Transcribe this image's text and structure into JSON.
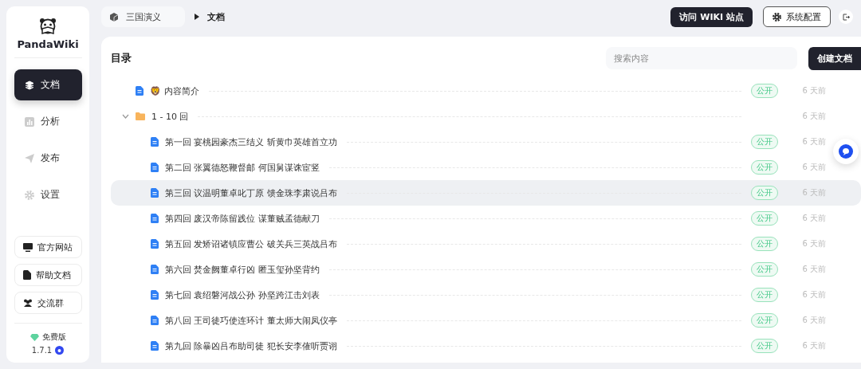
{
  "sidebar": {
    "logo": "PandaWiki",
    "nav": [
      {
        "label": "文档",
        "kind": "docs",
        "selected": true
      },
      {
        "label": "分析",
        "kind": "stats",
        "selected": false
      },
      {
        "label": "发布",
        "kind": "send",
        "selected": false
      },
      {
        "label": "设置",
        "kind": "gear",
        "selected": false
      }
    ],
    "links": [
      {
        "label": "官方网站",
        "kind": "monitor"
      },
      {
        "label": "帮助文档",
        "kind": "file"
      },
      {
        "label": "交流群",
        "kind": "group"
      }
    ],
    "edition": "免费版",
    "version": "1.7.1"
  },
  "header": {
    "breadcrumb": [
      "三国演义",
      "文档"
    ],
    "visit_button": "访问 WIKI 站点",
    "settings_button": "系统配置"
  },
  "catalog": {
    "title": "目录",
    "search": {
      "placeholder": "搜索内容"
    },
    "create_button": "创建文档",
    "items": [
      {
        "kind": "doc",
        "emoji": "🦁",
        "title": "内容简介",
        "status": "公开",
        "time": "6 天前",
        "selected": false
      },
      {
        "kind": "folder",
        "title": "1 - 10 回",
        "time": "6 天前",
        "expanded": true,
        "selected": false,
        "children": [
          {
            "kind": "doc",
            "title": "第一回 宴桃园豪杰三结义 斩黄巾英雄首立功",
            "status": "公开",
            "time": "6 天前",
            "selected": false
          },
          {
            "kind": "doc",
            "title": "第二回 张翼德怒鞭督邮 何国舅谋诛宦竖",
            "status": "公开",
            "time": "6 天前",
            "selected": false
          },
          {
            "kind": "doc",
            "title": "第三回 议温明董卓叱丁原 馈金珠李肃说吕布",
            "status": "公开",
            "time": "6 天前",
            "selected": true
          },
          {
            "kind": "doc",
            "title": "第四回 废汉帝陈留践位 谋董贼孟德献刀",
            "status": "公开",
            "time": "6 天前",
            "selected": false
          },
          {
            "kind": "doc",
            "title": "第五回 发矫诏诸镇应曹公 破关兵三英战吕布",
            "status": "公开",
            "time": "6 天前",
            "selected": false
          },
          {
            "kind": "doc",
            "title": "第六回 焚金阙董卓行凶 匿玉玺孙坚背约",
            "status": "公开",
            "time": "6 天前",
            "selected": false
          },
          {
            "kind": "doc",
            "title": "第七回 袁绍磐河战公孙 孙坚跨江击刘表",
            "status": "公开",
            "time": "6 天前",
            "selected": false
          },
          {
            "kind": "doc",
            "title": "第八回 王司徒巧使连环计 董太师大闹凤仪亭",
            "status": "公开",
            "time": "6 天前",
            "selected": false
          },
          {
            "kind": "doc",
            "title": "第九回 除暴凶吕布助司徒 犯长安李傕听贾诩",
            "status": "公开",
            "time": "6 天前",
            "selected": false
          }
        ]
      }
    ]
  }
}
